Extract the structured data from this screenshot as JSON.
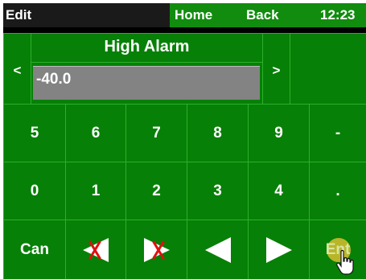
{
  "titlebar": {
    "edit_label": "Edit",
    "home_label": "Home",
    "back_label": "Back",
    "clock": "12:23"
  },
  "editor": {
    "prev_label": "<",
    "next_label": ">",
    "field_label": "High Alarm",
    "value": "-40.0"
  },
  "keypad": {
    "row1": [
      "5",
      "6",
      "7",
      "8",
      "9",
      "-"
    ],
    "row2": [
      "0",
      "1",
      "2",
      "3",
      "4",
      "."
    ],
    "cancel_label": "Can",
    "enter_label": "Ent",
    "icons": {
      "delete_left": "backspace-left-icon",
      "delete_right": "delete-right-icon",
      "move_left": "cursor-left-icon",
      "move_right": "cursor-right-icon",
      "pointer": "hand-pointer-icon"
    }
  },
  "colors": {
    "key_green": "#078007",
    "title_green": "#118c0e",
    "value_gray": "#838383",
    "delete_red": "#e01010"
  }
}
